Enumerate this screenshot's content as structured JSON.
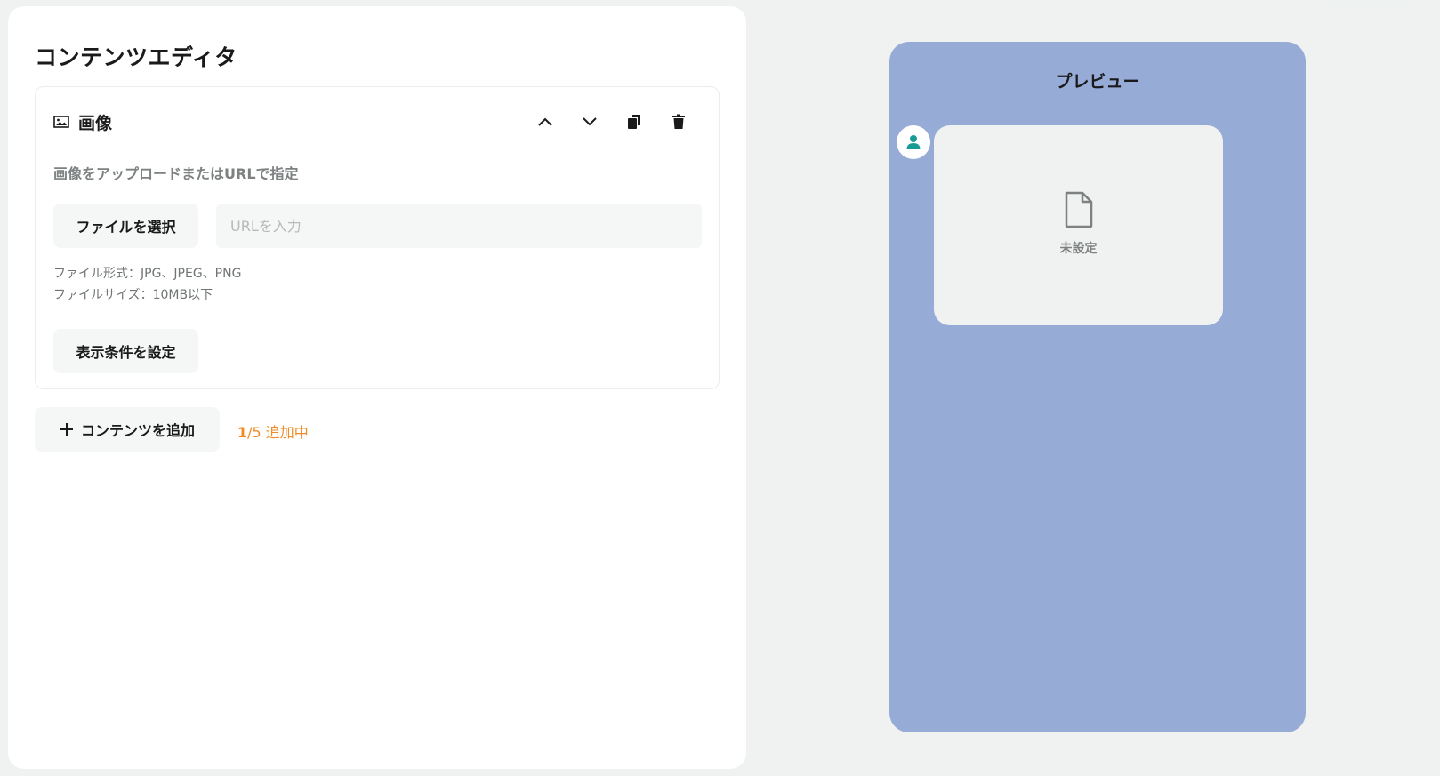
{
  "editor": {
    "title": "コンテンツエディタ",
    "block": {
      "type_label": "画像",
      "description": "画像をアップロードまたはURLで指定",
      "file_button_label": "ファイルを選択",
      "url_placeholder": "URLを入力",
      "file_format_note": "ファイル形式：JPG、JPEG、PNG",
      "file_size_note": "ファイルサイズ：10MB以下",
      "condition_button_label": "表示条件を設定"
    },
    "add_button_label": "コンテンツを追加",
    "count_current": "1",
    "count_suffix": "/5 追加中"
  },
  "preview": {
    "title": "プレビュー",
    "card_unset_label": "未設定"
  },
  "icons": {
    "block_type": "image-icon",
    "move_up": "chevron-up-icon",
    "move_down": "chevron-down-icon",
    "duplicate": "copy-icon",
    "delete": "trash-icon",
    "add": "plus-icon",
    "avatar": "user-icon",
    "placeholder": "file-icon"
  },
  "colors": {
    "accent_orange": "#f08a24",
    "preview_background": "#96abd6",
    "avatar_icon": "#1a9a94"
  }
}
